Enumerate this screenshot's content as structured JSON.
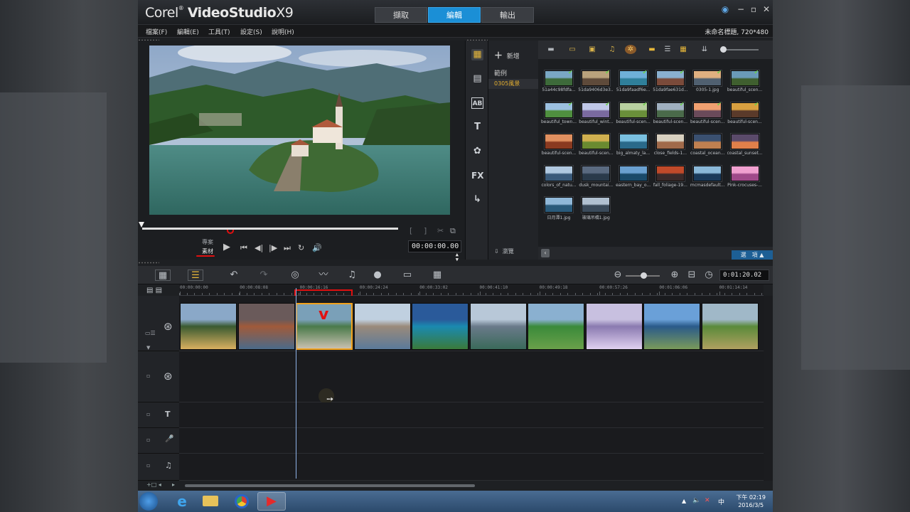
{
  "app": {
    "title": "Corel VideoStudio X9",
    "logo_prefix": "Corel",
    "logo_name": "VideoStudio",
    "logo_ver": "X9",
    "tabs": [
      "擷取",
      "編輯",
      "輸出"
    ],
    "active_tab": "編輯",
    "project_info": "未命名標題, 720*480"
  },
  "menu": [
    "檔案(F)",
    "編輯(E)",
    "工具(T)",
    "設定(S)",
    "說明(H)"
  ],
  "player": {
    "timecode": "00:00:00.00",
    "mode_project": "專案",
    "mode_clip": "素材"
  },
  "library": {
    "add_label": "新增",
    "folders": [
      "範例",
      "0305風景"
    ],
    "browse_label": "瀏覽",
    "options_label": "選　項",
    "items": [
      {
        "name": "51a44c98fdfa..."
      },
      {
        "name": "51da9406d3e3..."
      },
      {
        "name": "51da9faadf6e..."
      },
      {
        "name": "51da9fae631d..."
      },
      {
        "name": "0305-1.jpg"
      },
      {
        "name": "beautiful_scen..."
      },
      {
        "name": "beautiful_town..."
      },
      {
        "name": "beautiful_wint..."
      },
      {
        "name": "beautiful-scen..."
      },
      {
        "name": "beautiful-scen..."
      },
      {
        "name": "beautiful-scen..."
      },
      {
        "name": "beautiful-scen..."
      },
      {
        "name": "beautiful-scen..."
      },
      {
        "name": "beautiful-scen..."
      },
      {
        "name": "big_almaty_la..."
      },
      {
        "name": "close_fields-1..."
      },
      {
        "name": "coastal_ocean..."
      },
      {
        "name": "coastal_sunset..."
      },
      {
        "name": "colors_of_natu..."
      },
      {
        "name": "dusk_mountai..."
      },
      {
        "name": "eastern_bay_o..."
      },
      {
        "name": "fall_foliage-19..."
      },
      {
        "name": "mcmasdefault..."
      },
      {
        "name": "Pink-crocuses-..."
      },
      {
        "name": "日月潭1.jpg"
      },
      {
        "name": "玻璃吊橋1.jpg"
      }
    ]
  },
  "timeline": {
    "timecode": "0:01:20.02",
    "ruler": [
      "00:00:00:00",
      "00:00:08:08",
      "00:00:16:16",
      "00:00:24:24",
      "00:00:33:02",
      "00:00:41:10",
      "00:00:49:18",
      "00:00:57:26",
      "00:01:06:06",
      "00:01:14:14"
    ]
  },
  "taskbar": {
    "time": "下午 02:19",
    "date": "2016/3/5",
    "ime": "中"
  }
}
